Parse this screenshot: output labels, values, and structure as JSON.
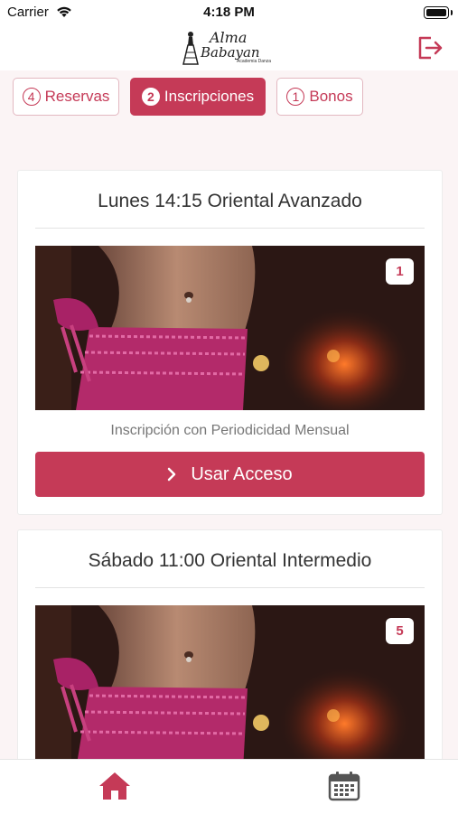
{
  "status": {
    "carrier": "Carrier",
    "time": "4:18 PM"
  },
  "header": {
    "logo_line1": "Alma",
    "logo_line2": "Babayan",
    "logo_line3": "Academia Danza"
  },
  "tabs": [
    {
      "count": "4",
      "label": "Reservas",
      "active": false
    },
    {
      "count": "2",
      "label": "Inscripciones",
      "active": true
    },
    {
      "count": "1",
      "label": "Bonos",
      "active": false
    }
  ],
  "cards": [
    {
      "title": "Lunes 14:15 Oriental Avanzado",
      "badge": "1",
      "subtitle": "Inscripción con Periodicidad Mensual",
      "button": "Usar Acceso"
    },
    {
      "title": "Sábado 11:00 Oriental Intermedio",
      "badge": "5"
    }
  ],
  "colors": {
    "accent": "#c53a57",
    "background": "#fbf4f5"
  },
  "icons": {
    "logout": "logout-icon",
    "home": "home-icon",
    "calendar": "calendar-icon"
  }
}
